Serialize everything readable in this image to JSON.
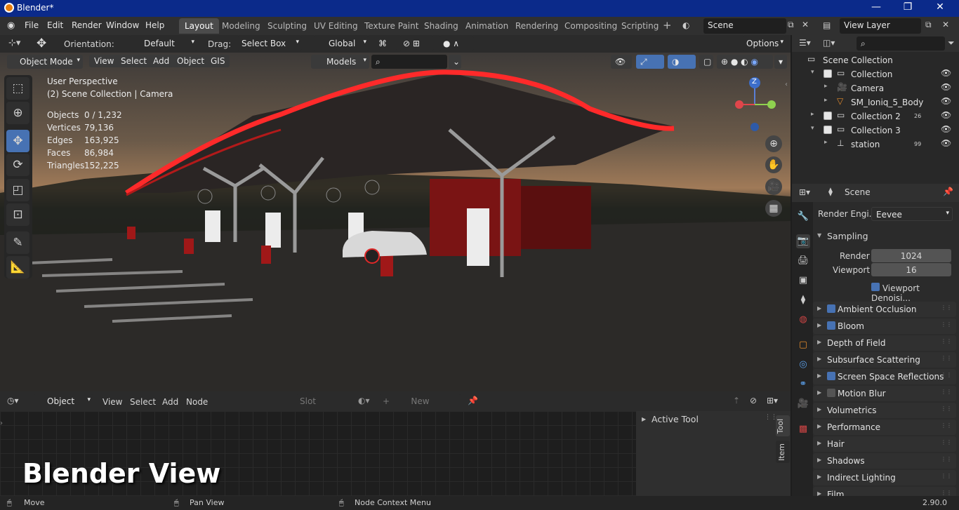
{
  "window": {
    "title": "Blender*",
    "controls": [
      "—",
      "❐",
      "✕"
    ]
  },
  "menu": {
    "items": [
      "File",
      "Edit",
      "Render",
      "Window",
      "Help"
    ]
  },
  "workspaces": [
    "Layout",
    "Modeling",
    "Sculpting",
    "UV Editing",
    "Texture Paint",
    "Shading",
    "Animation",
    "Rendering",
    "Compositing",
    "Scripting"
  ],
  "add_workspace": "+",
  "scene_name": "Scene",
  "view_layer": "View Layer",
  "toolbar": {
    "orientation_label": "Orientation:",
    "orientation_value": "Default",
    "drag_label": "Drag:",
    "drag_value": "Select Box",
    "transform_value": "Global",
    "options": "Options"
  },
  "viewport_header": {
    "mode": "Object Mode",
    "menus": [
      "View",
      "Select",
      "Add",
      "Object",
      "GIS"
    ],
    "models": "Models"
  },
  "overlay": {
    "perspective": "User Perspective",
    "context": "(2) Scene Collection | Camera",
    "stats": [
      {
        "label": "Objects",
        "value": "0 / 1,232"
      },
      {
        "label": "Vertices",
        "value": "79,136"
      },
      {
        "label": "Edges",
        "value": "163,925"
      },
      {
        "label": "Faces",
        "value": "86,984"
      },
      {
        "label": "Triangles",
        "value": "152,225"
      }
    ]
  },
  "gizmo": {
    "z_label": "Z"
  },
  "outliner": {
    "rows": [
      {
        "label": "Scene Collection",
        "indent": 0,
        "arrow": "",
        "icon": "collection-icon",
        "check": false,
        "eye": false
      },
      {
        "label": "Collection",
        "indent": 1,
        "arrow": "▾",
        "icon": "collection-icon",
        "check": true,
        "eye": true
      },
      {
        "label": "Camera",
        "indent": 2,
        "arrow": "▸",
        "icon": "camera-icon",
        "check": false,
        "eye": true
      },
      {
        "label": "SM_Ioniq_5_Body",
        "indent": 2,
        "arrow": "▸",
        "icon": "mesh-icon",
        "check": false,
        "eye": true
      },
      {
        "label": "Collection 2",
        "indent": 1,
        "arrow": "▸",
        "icon": "collection-icon",
        "check": true,
        "eye": true,
        "badge": "26"
      },
      {
        "label": "Collection 3",
        "indent": 1,
        "arrow": "▾",
        "icon": "collection-icon",
        "check": true,
        "eye": true
      },
      {
        "label": "station",
        "indent": 2,
        "arrow": "▸",
        "icon": "empty-icon",
        "check": false,
        "eye": true,
        "badge": "99"
      }
    ]
  },
  "properties": {
    "title": "Scene",
    "render_engine_label": "Render Engi...",
    "render_engine": "Eevee",
    "sampling": "Sampling",
    "render_label": "Render",
    "render_value": "1024",
    "viewport_label": "Viewport",
    "viewport_value": "16",
    "viewport_denoise": "Viewport Denoisi...",
    "panels": [
      {
        "label": "Ambient Occlusion",
        "check": true
      },
      {
        "label": "Bloom",
        "check": true
      },
      {
        "label": "Depth of Field",
        "check": null
      },
      {
        "label": "Subsurface Scattering",
        "check": null
      },
      {
        "label": "Screen Space Reflections",
        "check": true
      },
      {
        "label": "Motion Blur",
        "check": false
      },
      {
        "label": "Volumetrics",
        "check": null
      },
      {
        "label": "Performance",
        "check": null
      },
      {
        "label": "Hair",
        "check": null
      },
      {
        "label": "Shadows",
        "check": null
      },
      {
        "label": "Indirect Lighting",
        "check": null
      },
      {
        "label": "Film",
        "check": null
      }
    ]
  },
  "node_editor": {
    "object": "Object",
    "menus": [
      "View",
      "Select",
      "Add",
      "Node"
    ],
    "slot": "Slot",
    "new": "New",
    "active_tool": "Active Tool",
    "tabs": [
      "Tool",
      "Item"
    ]
  },
  "caption": "Blender View",
  "status": {
    "move": "Move",
    "pan": "Pan View",
    "node": "Node Context Menu",
    "version": "2.90.0"
  }
}
